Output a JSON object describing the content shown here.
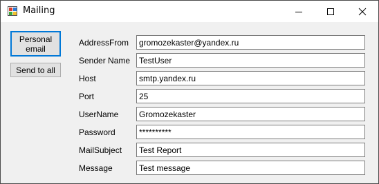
{
  "window": {
    "title": "Mailing",
    "icon": "app-icon"
  },
  "titlebar_buttons": {
    "minimize": "minimize-icon",
    "maximize": "maximize-icon",
    "close": "close-icon"
  },
  "buttons": {
    "personal": "Personal email",
    "send_all": "Send to all"
  },
  "fields": [
    {
      "label": "AddressFrom",
      "value": "gromozekaster@yandex.ru"
    },
    {
      "label": "Sender Name",
      "value": "TestUser"
    },
    {
      "label": "Host",
      "value": "smtp.yandex.ru"
    },
    {
      "label": "Port",
      "value": "25"
    },
    {
      "label": "UserName",
      "value": "Gromozekaster"
    },
    {
      "label": "Password",
      "value": "**********"
    },
    {
      "label": "MailSubject",
      "value": "Test Report"
    },
    {
      "label": "Message",
      "value": "Test message"
    }
  ],
  "colors": {
    "accent": "#0078d7",
    "window_bg": "#f0f0f0",
    "titlebar_bg": "#ffffff"
  }
}
